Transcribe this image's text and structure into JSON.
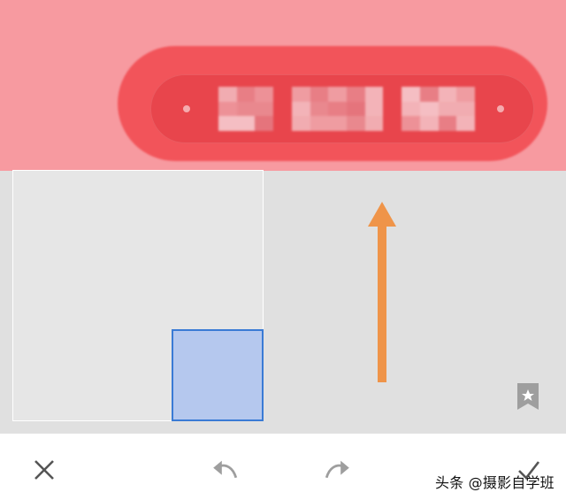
{
  "colors": {
    "preview_bg": "#f79aa0",
    "highlight": "#f2545a",
    "pill": "#e8454c",
    "work_area_bg": "#e0e0e0",
    "selection_border": "#3a7bd5",
    "selection_fill": "#b5c8ee",
    "arrow": "#ef9449",
    "icon_gray": "#9e9e9e",
    "icon_dark": "#555555"
  },
  "preview": {
    "blurred_text_icon": "pixelated-redaction"
  },
  "canvas": {
    "crop_frame_icon": "crop-frame",
    "selection_icon": "rectangle-selection",
    "arrow_icon": "up-arrow-annotation",
    "bookmark_icon": "bookmark-star-icon"
  },
  "toolbar": {
    "close_icon": "close-icon",
    "undo_icon": "undo-icon",
    "redo_icon": "redo-icon",
    "done_icon": "check-icon"
  },
  "watermark": {
    "text": "头条 @摄影自学班"
  }
}
